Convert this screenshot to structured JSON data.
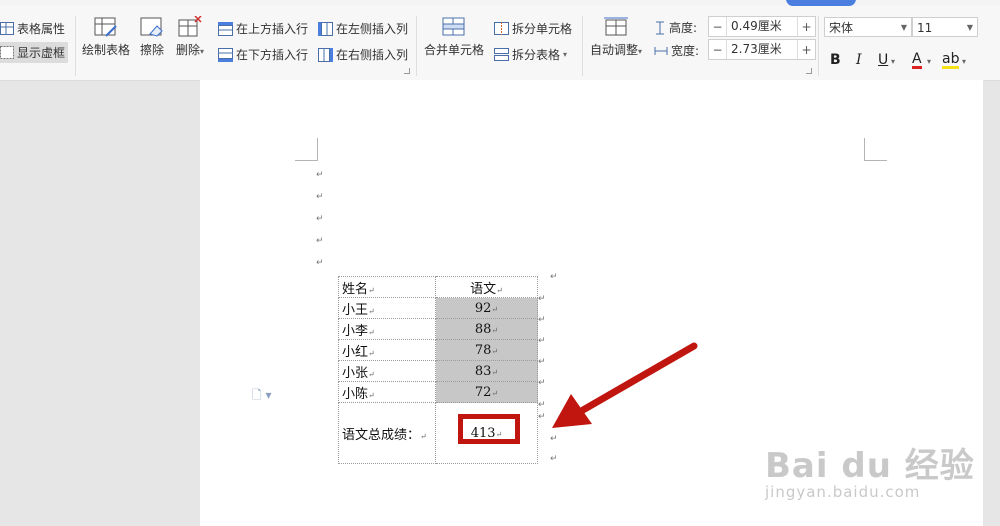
{
  "ribbon": {
    "table_properties": "表格属性",
    "show_gridlines": "显示虚框",
    "draw_table": "绘制表格",
    "erase": "擦除",
    "delete": "删除",
    "insert_row_above": "在上方插入行",
    "insert_row_below": "在下方插入行",
    "insert_col_left": "在左侧插入列",
    "insert_col_right": "在右侧插入列",
    "merge_cells": "合并单元格",
    "split_cells": "拆分单元格",
    "split_table": "拆分表格",
    "auto_fit": "自动调整",
    "height_label": "高度:",
    "height_value": "0.49厘米",
    "width_label": "宽度:",
    "width_value": "2.73厘米",
    "font_name": "宋体",
    "font_size": "11",
    "bold": "B",
    "italic": "I",
    "underline": "U",
    "font_color": "A",
    "highlight": "ab"
  },
  "table": {
    "header_name": "姓名",
    "header_subject": "语文",
    "rows": [
      {
        "name": "小王",
        "score": "92"
      },
      {
        "name": "小李",
        "score": "88"
      },
      {
        "name": "小红",
        "score": "78"
      },
      {
        "name": "小张",
        "score": "83"
      },
      {
        "name": "小陈",
        "score": "72"
      }
    ],
    "total_label": "语文总成绩：",
    "total_value": "413"
  },
  "watermark": {
    "logo": "Bai du 经验",
    "url": "jingyan.baidu.com"
  },
  "colors": {
    "accent": "#4a7fe0",
    "annotation": "#c0160f",
    "cell_shade": "#c7c7c7"
  }
}
